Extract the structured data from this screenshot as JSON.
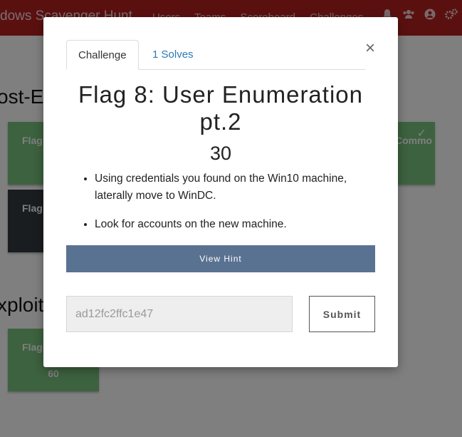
{
  "navbar": {
    "brand": "dows Scavenger Hunt",
    "links": [
      "Users",
      "Teams",
      "Scoreboard",
      "Challenges"
    ],
    "icons": [
      "bell-icon",
      "team-icon",
      "user-icon",
      "settings-icon"
    ]
  },
  "background": {
    "categories": [
      {
        "title": "ost-E"
      },
      {
        "title": "xploit"
      }
    ],
    "cards": [
      {
        "title": "Flag",
        "value": ""
      },
      {
        "title": "Flag",
        "value": ""
      },
      {
        "title": "Flag",
        "value": "60"
      },
      {
        "title": "Commo",
        "value": ""
      }
    ]
  },
  "modal": {
    "close_symbol": "×",
    "tabs": [
      {
        "label": "Challenge"
      },
      {
        "label": "1 Solves"
      }
    ],
    "title": "Flag 8: User Enumeration pt.2",
    "value": "30",
    "description": [
      "Using credentials you found on the Win10 machine, laterally move to WinDC.",
      "Look for accounts on the new machine."
    ],
    "hint_label": "View Hint",
    "flag_input_value": "ad12fc2ffc1e47",
    "submit_label": "Submit"
  },
  "colors": {
    "navbar": "#b72020",
    "hint_button": "#5a7291",
    "solved_card": "#7bc47e",
    "unsolved_card": "#343a40",
    "tab_link": "#2a7ab8"
  }
}
